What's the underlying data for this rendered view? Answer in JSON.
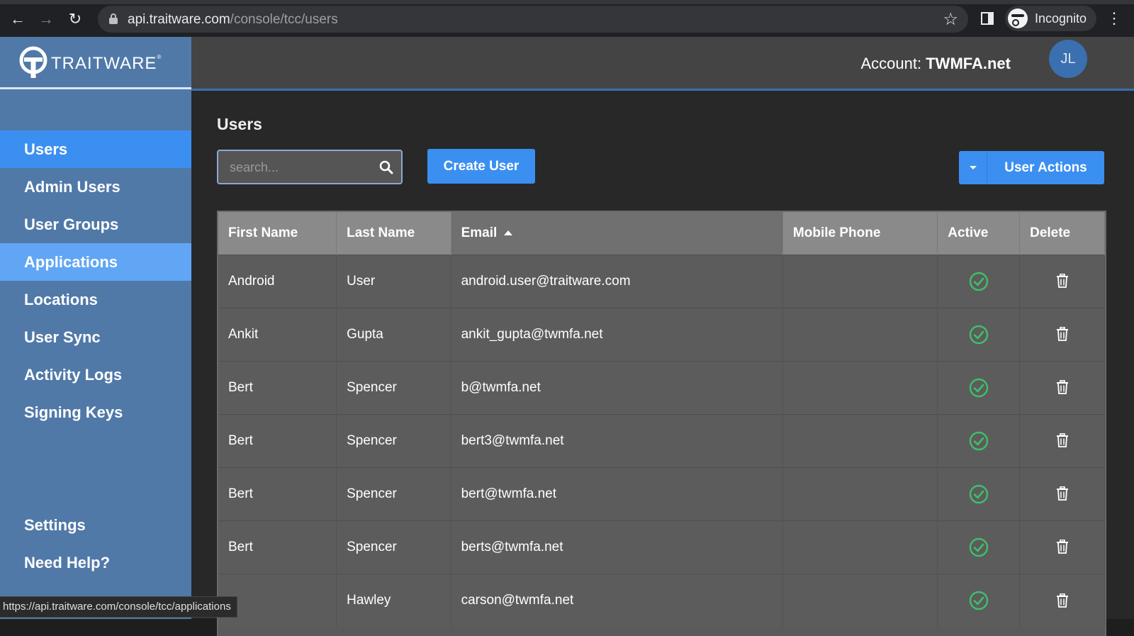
{
  "browser": {
    "url_host": "api.traitware.com",
    "url_path": "/console/tcc/users",
    "profile_label": "Incognito"
  },
  "brand": {
    "name": "TRAITWARE",
    "mark": "®"
  },
  "sidebar": {
    "items": [
      {
        "label": "Users",
        "state": "active"
      },
      {
        "label": "Admin Users",
        "state": ""
      },
      {
        "label": "User Groups",
        "state": ""
      },
      {
        "label": "Applications",
        "state": "hover"
      },
      {
        "label": "Locations",
        "state": ""
      },
      {
        "label": "User Sync",
        "state": ""
      },
      {
        "label": "Activity Logs",
        "state": ""
      },
      {
        "label": "Signing Keys",
        "state": ""
      }
    ],
    "bottom_items": [
      {
        "label": "Settings"
      },
      {
        "label": "Need Help?"
      }
    ]
  },
  "header": {
    "account_prefix": "Account:",
    "account_name": "TWMFA.net",
    "avatar_initials": "JL"
  },
  "main": {
    "title": "Users",
    "search_placeholder": "search...",
    "create_button": "Create User",
    "actions_button": "User Actions"
  },
  "table": {
    "columns": [
      "First Name",
      "Last Name",
      "Email",
      "Mobile Phone",
      "Active",
      "Delete"
    ],
    "sorted_column": "Email",
    "rows": [
      {
        "first": "Android",
        "last": "User",
        "email": "android.user@traitware.com",
        "phone": "",
        "active": true
      },
      {
        "first": "Ankit",
        "last": "Gupta",
        "email": "ankit_gupta@twmfa.net",
        "phone": "",
        "active": true
      },
      {
        "first": "Bert",
        "last": "Spencer",
        "email": "b@twmfa.net",
        "phone": "",
        "active": true
      },
      {
        "first": "Bert",
        "last": "Spencer",
        "email": "bert3@twmfa.net",
        "phone": "",
        "active": true
      },
      {
        "first": "Bert",
        "last": "Spencer",
        "email": "bert@twmfa.net",
        "phone": "",
        "active": true
      },
      {
        "first": "Bert",
        "last": "Spencer",
        "email": "berts@twmfa.net",
        "phone": "",
        "active": true
      },
      {
        "first": "",
        "last": "Hawley",
        "email": "carson@twmfa.net",
        "phone": "",
        "active": true
      }
    ]
  },
  "status_bar": {
    "hover_url": "https://api.traitware.com/console/tcc/applications"
  },
  "colors": {
    "accent": "#3b8ff0",
    "sidebar": "#5079a8",
    "active_check": "#3fbf6a"
  },
  "icons": [
    "back-icon",
    "forward-icon",
    "reload-icon",
    "lock-icon",
    "star-icon",
    "side-panel-icon",
    "incognito-icon",
    "more-icon",
    "traitware-logo",
    "search-icon",
    "caret-down-icon",
    "sort-asc-icon",
    "check-circle-icon",
    "trash-icon"
  ]
}
